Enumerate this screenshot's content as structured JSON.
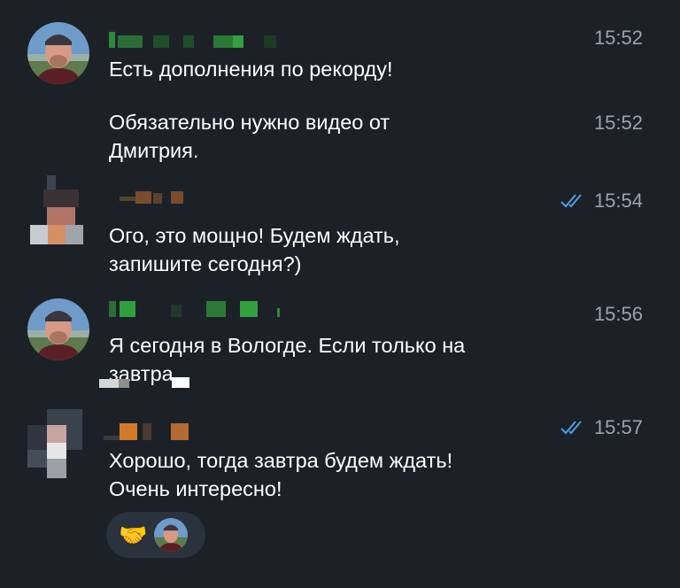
{
  "messages": [
    {
      "time": "15:52",
      "text": "Есть дополнения по рекорду!",
      "read": false
    },
    {
      "time": "15:52",
      "text": "Обязательно нужно видео от\nДмитрия.",
      "read": false
    },
    {
      "time": "15:54",
      "text": "Ого, это мощно! Будем ждать,\nзапишите сегодня?)",
      "read": true
    },
    {
      "time": "15:56",
      "text": "Я сегодня в Вологде. Если только на\nзавтра",
      "read": false
    },
    {
      "time": "15:57",
      "text": "Хорошо, тогда завтра будем ждать!\nОчень интересно!",
      "read": true
    }
  ],
  "reaction": {
    "emoji": "🤝"
  },
  "colors": {
    "background": "#1c2128",
    "text": "#ffffff",
    "time": "#9aa3ad",
    "read_check": "#4d9ee8",
    "reaction_bg": "#29323d"
  },
  "icons": [
    "avatar-photo",
    "pixelated-avatar",
    "double-check-icon",
    "handshake-emoji"
  ]
}
